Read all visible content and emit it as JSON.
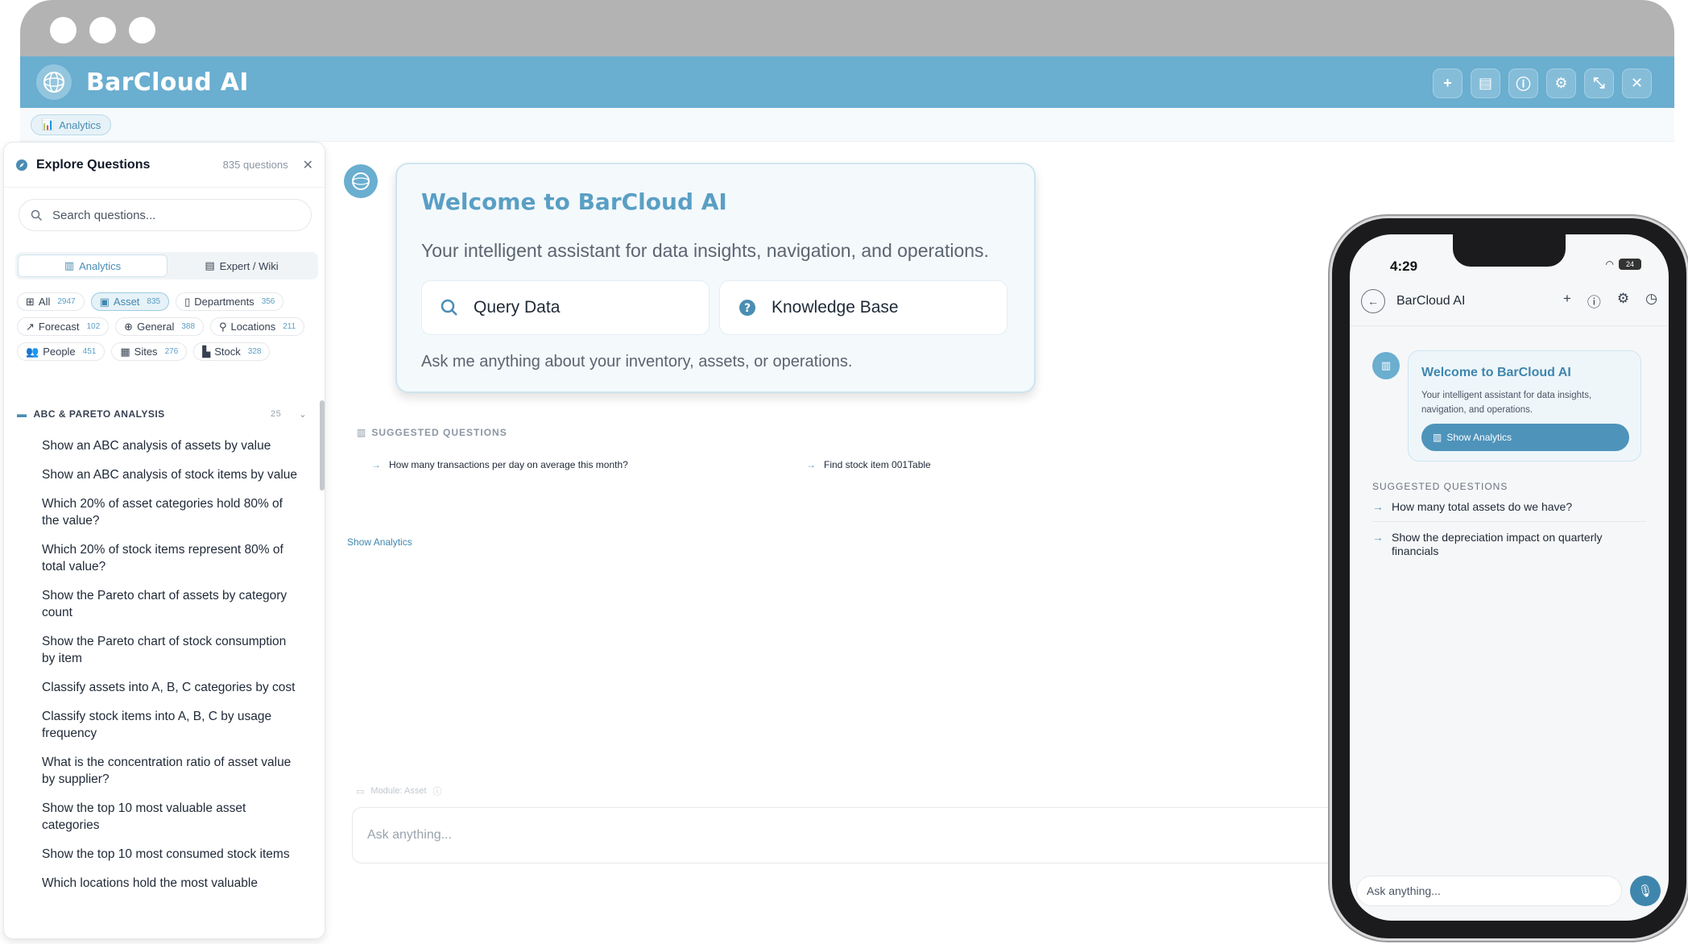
{
  "window": {
    "title": "BarCloud AI"
  },
  "header": {
    "actions": [
      "plus-icon",
      "book-icon",
      "info-icon",
      "gear-icon",
      "expand-icon",
      "close-icon"
    ]
  },
  "subbar": {
    "chip_label": "Analytics"
  },
  "sidebar": {
    "title": "Explore Questions",
    "count": "835 questions",
    "search_placeholder": "Search questions...",
    "tabs": [
      {
        "label": "Analytics"
      },
      {
        "label": "Expert / Wiki"
      }
    ],
    "filters": [
      {
        "label": "All",
        "count": "2947"
      },
      {
        "label": "Asset",
        "count": "835"
      },
      {
        "label": "Departments",
        "count": "356"
      },
      {
        "label": "Forecast",
        "count": "102"
      },
      {
        "label": "General",
        "count": "388"
      },
      {
        "label": "Locations",
        "count": "211"
      },
      {
        "label": "People",
        "count": "451"
      },
      {
        "label": "Sites",
        "count": "276"
      },
      {
        "label": "Stock",
        "count": "328"
      }
    ],
    "group": {
      "title": "ABC & PARETO ANALYSIS",
      "count": "25"
    },
    "questions": [
      "Show an ABC analysis of assets by value",
      "Show an ABC analysis of stock items by value",
      "Which 20% of asset categories hold 80% of the value?",
      "Which 20% of stock items represent 80% of total value?",
      "Show the Pareto chart of assets by category count",
      "Show the Pareto chart of stock consumption by item",
      "Classify assets into A, B, C categories by cost",
      "Classify stock items into A, B, C by usage frequency",
      "What is the concentration ratio of asset value by supplier?",
      "Show the top 10 most valuable asset categories",
      "Show the top 10 most consumed stock items",
      "Which locations hold the most valuable"
    ]
  },
  "chat": {
    "welcome": {
      "title": "Welcome to BarCloud AI",
      "subtitle": "Your intelligent assistant for data insights, navigation, and operations.",
      "card1": "Query Data",
      "card2": "Knowledge Base",
      "footer": "Ask me anything about your inventory, assets, or operations."
    },
    "suggested_label": "SUGGESTED QUESTIONS",
    "suggestions": [
      "How many transactions per day on average this month?",
      "Find stock item 001Table"
    ],
    "show_analytics": "Show Analytics",
    "module_label": "Module: Asset",
    "input_placeholder": "Ask anything..."
  },
  "phone": {
    "time": "4:29",
    "battery": "24",
    "title": "BarCloud AI",
    "welcome_title": "Welcome to BarCloud AI",
    "welcome_sub": "Your intelligent assistant for data insights, navigation, and operations.",
    "show_analytics": "Show Analytics",
    "suggested_label": "SUGGESTED QUESTIONS",
    "suggestions": [
      "How many total assets do we have?",
      "Show the depreciation impact on quarterly financials"
    ],
    "input_placeholder": "Ask anything..."
  },
  "colors": {
    "brand": "#6aaed0",
    "accent": "#3f86ad"
  }
}
